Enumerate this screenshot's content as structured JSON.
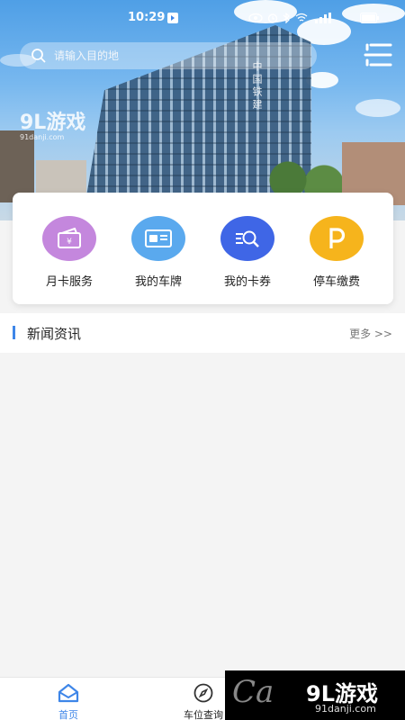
{
  "status_bar": {
    "time": "10:29"
  },
  "header": {
    "building_sign": "中国铁建",
    "watermark_brand": "9L游戏",
    "watermark_site": "91danji.com"
  },
  "search": {
    "placeholder": "请输入目的地",
    "value": ""
  },
  "services": [
    {
      "label": "月卡服务",
      "color": "#c487dd",
      "icon": "wallet-icon"
    },
    {
      "label": "我的车牌",
      "color": "#5aa9ee",
      "icon": "license-plate-icon"
    },
    {
      "label": "我的卡券",
      "color": "#3f66e6",
      "icon": "coupon-search-icon"
    },
    {
      "label": "停车缴费",
      "color": "#f6b41c",
      "icon": "parking-icon"
    }
  ],
  "news": {
    "title": "新闻资讯",
    "more": "更多 >>"
  },
  "tabs": [
    {
      "label": "首页",
      "icon": "home-icon",
      "active": true,
      "active_color": "#3e86e8"
    },
    {
      "label": "车位查询",
      "icon": "compass-icon",
      "active": false
    }
  ],
  "corner_watermark": {
    "brand": "9L游戏",
    "site": "91danji.com"
  }
}
